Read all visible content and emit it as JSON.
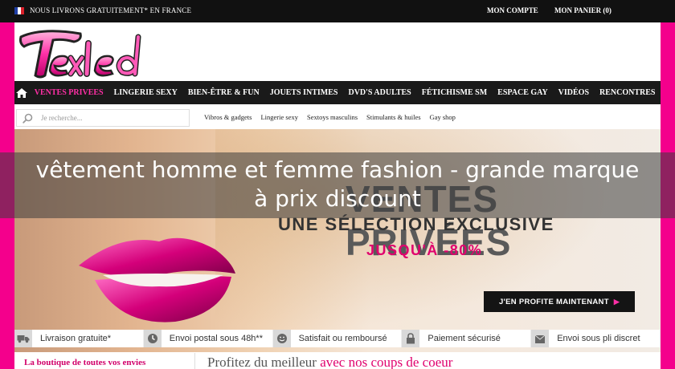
{
  "topbar": {
    "shipping": "NOUS LIVRONS GRATUITEMENT* EN FRANCE",
    "account": "MON COMPTE",
    "cart": "MON PANIER (0)"
  },
  "logo": {
    "text": "Texled"
  },
  "nav": {
    "items": [
      "VENTES PRIVEES",
      "LINGERIE SEXY",
      "BIEN-ÊTRE & FUN",
      "JOUETS INTIMES",
      "DVD'S ADULTES",
      "FÉTICHISME SM",
      "ESPACE GAY",
      "VIDÉOS",
      "RENCONTRES"
    ]
  },
  "search": {
    "placeholder": "Je recherche..."
  },
  "sublinks": [
    "Vibros & gadgets",
    "Lingerie sexy",
    "Sextoys masculins",
    "Stimulants & huiles",
    "Gay shop"
  ],
  "hero": {
    "title": "VENTES PRIVÉES",
    "subtitle": "UNE SÉLECTION EXCLUSIVE",
    "discount": "JUSQU'À -80%",
    "cta": "J'EN PROFITE MAINTENANT",
    "cta_arrow": "▶"
  },
  "overlay": {
    "title_line1": "vêtement homme et femme fashion - grande marque",
    "title_line2": "à prix discount"
  },
  "features": [
    {
      "icon": "truck-icon",
      "label": "Livraison gratuite*"
    },
    {
      "icon": "clock-icon",
      "label": "Envoi postal sous 48h**"
    },
    {
      "icon": "smiley-icon",
      "label": "Satisfait ou remboursé"
    },
    {
      "icon": "lock-icon",
      "label": "Paiement sécurisé"
    },
    {
      "icon": "box-icon",
      "label": "Envoi sous pli discret"
    }
  ],
  "bottom": {
    "left": "La boutique de toutes vos envies",
    "main_prefix": "Profitez du meilleur ",
    "main_highlight": "avec nos coups de coeur"
  },
  "colors": {
    "brand_pink": "#f4008c",
    "accent_pink": "#ff2fa6",
    "dark": "#111111"
  }
}
